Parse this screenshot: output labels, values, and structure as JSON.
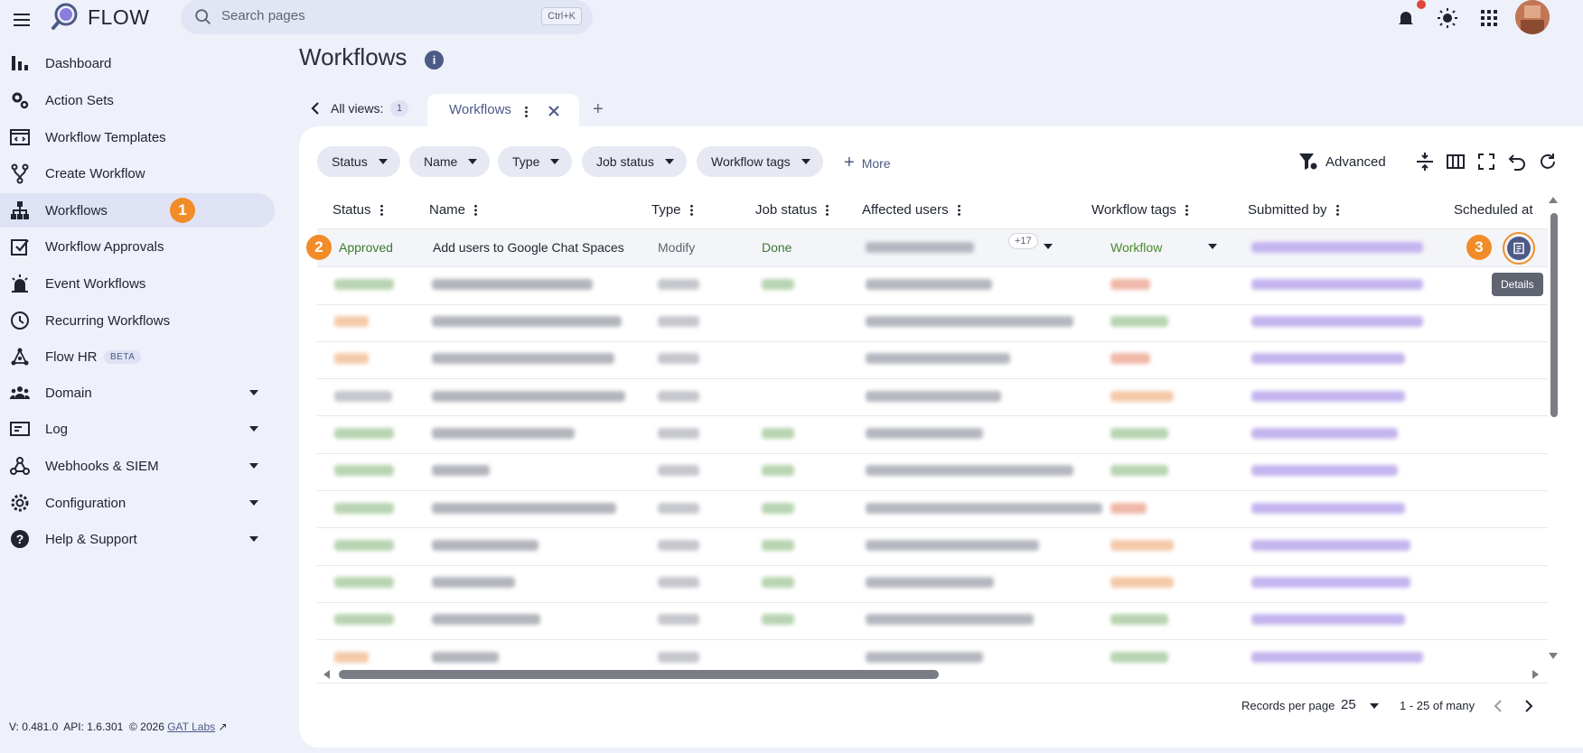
{
  "app": {
    "name": "FLOW"
  },
  "search": {
    "placeholder": "Search pages",
    "shortcut": "Ctrl+K"
  },
  "sidebar": {
    "items": [
      {
        "label": "Dashboard",
        "icon": "bar-chart-icon"
      },
      {
        "label": "Action Sets",
        "icon": "gears-icon"
      },
      {
        "label": "Workflow Templates",
        "icon": "template-icon"
      },
      {
        "label": "Create Workflow",
        "icon": "branch-icon"
      },
      {
        "label": "Workflows",
        "icon": "hierarchy-icon",
        "active": true
      },
      {
        "label": "Workflow Approvals",
        "icon": "checkbox-icon"
      },
      {
        "label": "Event Workflows",
        "icon": "alarm-icon"
      },
      {
        "label": "Recurring Workflows",
        "icon": "clock-icon"
      },
      {
        "label": "Flow HR",
        "icon": "network-icon",
        "badge": "BETA"
      },
      {
        "label": "Domain",
        "icon": "people-icon",
        "expandable": true
      },
      {
        "label": "Log",
        "icon": "log-icon",
        "expandable": true
      },
      {
        "label": "Webhooks & SIEM",
        "icon": "webhook-icon",
        "expandable": true
      },
      {
        "label": "Configuration",
        "icon": "gear-icon",
        "expandable": true
      },
      {
        "label": "Help & Support",
        "icon": "help-icon",
        "expandable": true
      }
    ],
    "footer": {
      "version": "V: 0.481.0",
      "api": "API: 1.6.301",
      "copyright": "© 2026",
      "company": "GAT Labs"
    }
  },
  "steps": {
    "one": "1",
    "two": "2",
    "three": "3"
  },
  "page": {
    "title": "Workflows"
  },
  "views": {
    "label": "All views:",
    "count": "1",
    "tab_label": "Workflows",
    "add": "+"
  },
  "filters": {
    "chips": [
      "Status",
      "Name",
      "Type",
      "Job status",
      "Workflow tags"
    ],
    "more": "More",
    "advanced": "Advanced"
  },
  "table": {
    "columns": [
      "Status",
      "Name",
      "Type",
      "Job status",
      "Affected users",
      "Workflow tags",
      "Submitted by",
      "Scheduled at"
    ],
    "first_row": {
      "status": "Approved",
      "name": "Add users to Google Chat Spaces",
      "type": "Modify",
      "job_status": "Done",
      "users_count": "+17",
      "tag": "Workflow"
    },
    "tooltip": "Details"
  },
  "pagination": {
    "label": "Records per page",
    "per_page": "25",
    "range": "1 - 25 of many"
  },
  "colors": {
    "accent": "#4d5a86",
    "step": "#f28c28",
    "approved": "#3a7a2e",
    "tag": "#4a8a2a",
    "submitter": "#8a6fd0"
  }
}
